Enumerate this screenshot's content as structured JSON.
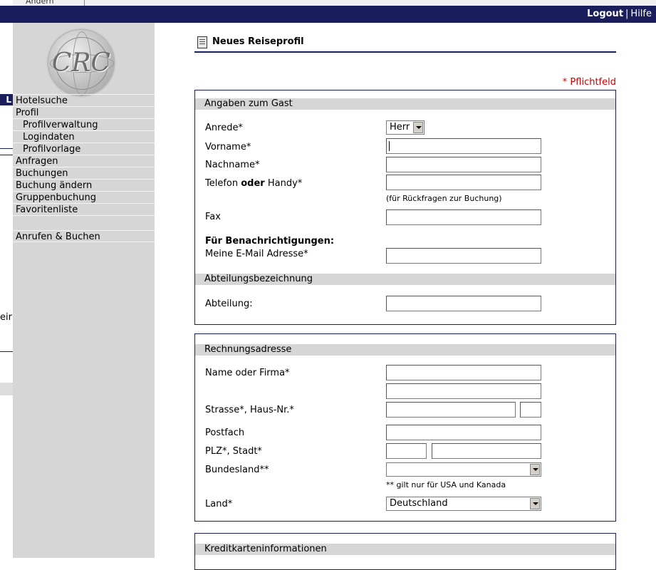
{
  "window": {
    "tab_text": "Ändern"
  },
  "background": {
    "letter": "L",
    "fragment": "eir"
  },
  "header": {
    "logout_label": "Logout",
    "separator": "|",
    "help_label": "Hilfe"
  },
  "logo": {
    "text": "CRC"
  },
  "sidebar": {
    "items": [
      {
        "label": "Hotelsuche"
      },
      {
        "label": "Profil"
      },
      {
        "label": "Profilverwaltung"
      },
      {
        "label": "Logindaten"
      },
      {
        "label": "Profilvorlage"
      },
      {
        "label": "Anfragen"
      },
      {
        "label": "Buchungen"
      },
      {
        "label": "Buchung ändern"
      },
      {
        "label": "Gruppenbuchung"
      },
      {
        "label": "Favoritenliste"
      }
    ],
    "call_label": "Anrufen & Buchen"
  },
  "page": {
    "title": "Neues Reiseprofil",
    "required_note": "* Pflichtfeld"
  },
  "guest": {
    "section_title": "Angaben zum Gast",
    "salutation_label": "Anrede*",
    "salutation_value": "Herr",
    "firstname_label": "Vorname*",
    "lastname_label": "Nachname*",
    "phone_label_a": "Telefon ",
    "phone_label_or": "oder",
    "phone_label_b": " Handy*",
    "phone_hint": "(für Rückfragen zur Buchung)",
    "fax_label": "Fax",
    "notifications_heading": "Für Benachrichtigungen:",
    "email_label": "Meine E-Mail Adresse*",
    "department_section_title": "Abteilungsbezeichnung",
    "department_label": "Abteilung:"
  },
  "billing": {
    "section_title": "Rechnungsadresse",
    "name_label": "Name oder Firma*",
    "street_label": "Strasse*, Haus-Nr.*",
    "pobox_label": "Postfach",
    "zipcity_label": "PLZ*, Stadt*",
    "state_label": "Bundesland**",
    "state_value": "",
    "state_hint": "** gilt nur für USA und Kanada",
    "country_label": "Land*",
    "country_value": "Deutschland"
  },
  "card": {
    "section_title": "Kreditkarteninformationen"
  }
}
